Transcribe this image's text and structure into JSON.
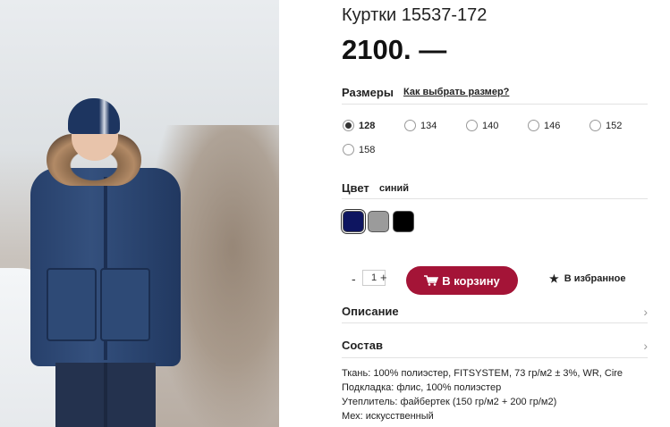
{
  "product": {
    "title": "Куртки 15537-172",
    "price": "2100. —"
  },
  "sizes": {
    "label": "Размеры",
    "help_link": "Как выбрать размер?",
    "options": [
      {
        "value": "128",
        "selected": true
      },
      {
        "value": "134",
        "selected": false
      },
      {
        "value": "140",
        "selected": false
      },
      {
        "value": "146",
        "selected": false
      },
      {
        "value": "152",
        "selected": false
      },
      {
        "value": "158",
        "selected": false
      }
    ]
  },
  "color": {
    "label": "Цвет",
    "selected_name": "синий",
    "swatches": [
      {
        "hex": "#0e1560",
        "selected": true
      },
      {
        "hex": "#9b9b9b",
        "selected": false
      },
      {
        "hex": "#000000",
        "selected": false
      }
    ]
  },
  "purchase": {
    "qty_minus": "-",
    "quantity": "1",
    "qty_plus": "+",
    "cart_button": "В корзину",
    "favorite_icon": "star-icon",
    "favorite": "В избранное",
    "accent_color": "#a41437"
  },
  "accordion": {
    "description": "Описание",
    "composition": "Состав",
    "chevron": "›"
  },
  "composition_lines": [
    "Ткань: 100% полиэстер, FITSYSTEM, 73 гр/м2 ± 3%, WR, Cire",
    "Подкладка: флис, 100% полиэстер",
    "Утеплитель: файбертек (150 гр/м2 + 200 гр/м2)",
    "Мех: искусственный"
  ]
}
